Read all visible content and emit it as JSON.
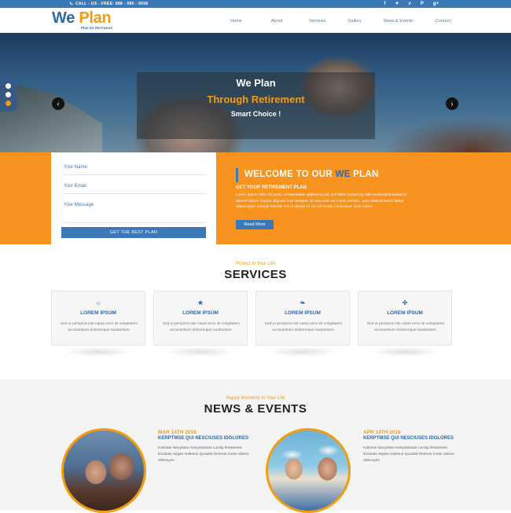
{
  "topbar": {
    "call": "CALL - US - FREE: 888 - 585 - 9658",
    "social": [
      "f-icon",
      "twitter-icon",
      "v-icon",
      "pinterest-icon",
      "gplus-icon"
    ],
    "social_glyphs": [
      "f",
      "✦",
      "v",
      "P",
      "g+"
    ]
  },
  "header": {
    "logo_we": "We",
    "logo_plan": "Plan",
    "tagline": "Plan for the Future"
  },
  "nav": [
    "Home",
    "About",
    "Services",
    "Gallery",
    "News & Events",
    "Contact"
  ],
  "hero": {
    "line1": "We Plan",
    "line2": "Through Retirement",
    "line3": "Smart Choice !",
    "prev": "‹",
    "next": "›"
  },
  "form": {
    "name": "Your Name",
    "email": "Your Email",
    "message": "Your Message",
    "submit": "GET THE BEST PLAN"
  },
  "welcome": {
    "title_a": "WELCOME TO OUR ",
    "title_we": "WE",
    "title_b": " PLAN",
    "subtitle": "GET YOUR RETIREMENT PLAN",
    "text": "Lorem ipsum dolor sit amet, consectetuer adipiscing elit, sed diam nonummy nibh euismod tincidunt ut laoreet dolore magna aliquam erat volutpat. Ut wisi enim ad minim veniam, quis nostrud exerci tation ullamcorper suscipit lobortis nisl ut aliquip ex ea commodo consequat. Duis autem",
    "button": "Read More"
  },
  "services": {
    "subtitle": "Protect in Your Life",
    "title": "SERVICES",
    "cards": [
      {
        "icon": "☼",
        "title": "LOREM IPSUM",
        "text": "Sed ut perspicis iste natus error sit voluptatem accusantium doloremque laudantium."
      },
      {
        "icon": "★",
        "title": "LOREM IPSUM",
        "text": "Sed ut perspicis iste natus error sit voluptatem accusantium doloremque laudantium."
      },
      {
        "icon": "❧",
        "title": "LOREM IPSUM",
        "text": "Sed ut perspicis iste natus error sit voluptatem accusantium doloremque laudantium."
      },
      {
        "icon": "✣",
        "title": "LOREM IPSUM",
        "text": "Sed ut perspicis iste natus error sit voluptatem accusantium doloremque laudantium."
      }
    ]
  },
  "news": {
    "subtitle": "Happy Moments in Your Life",
    "title": "NEWS & EVENTS",
    "items": [
      {
        "date": "MAR 14TH 2016",
        "heading": "KERPTMSE QUI NESCIUSES IDOLORES",
        "text": "Katnsas lasuytasa masyutasdas Lundg fertaseans kinasatu segiat malesuo tyuadeb ferteras mose olasce doleruyes"
      },
      {
        "date": "APR 14TH 2016",
        "heading": "KERPTMSE QUI NESCIUSES IDOLORES",
        "text": "Katnsas lasuytasa masyutasdas Lundg fertaseans kinasatu segiat malesuo tyuadeb ferteras mose olasce doleruyes"
      }
    ]
  },
  "colors": {
    "brand_blue": "#3a78b8",
    "brand_orange": "#f7931e"
  }
}
